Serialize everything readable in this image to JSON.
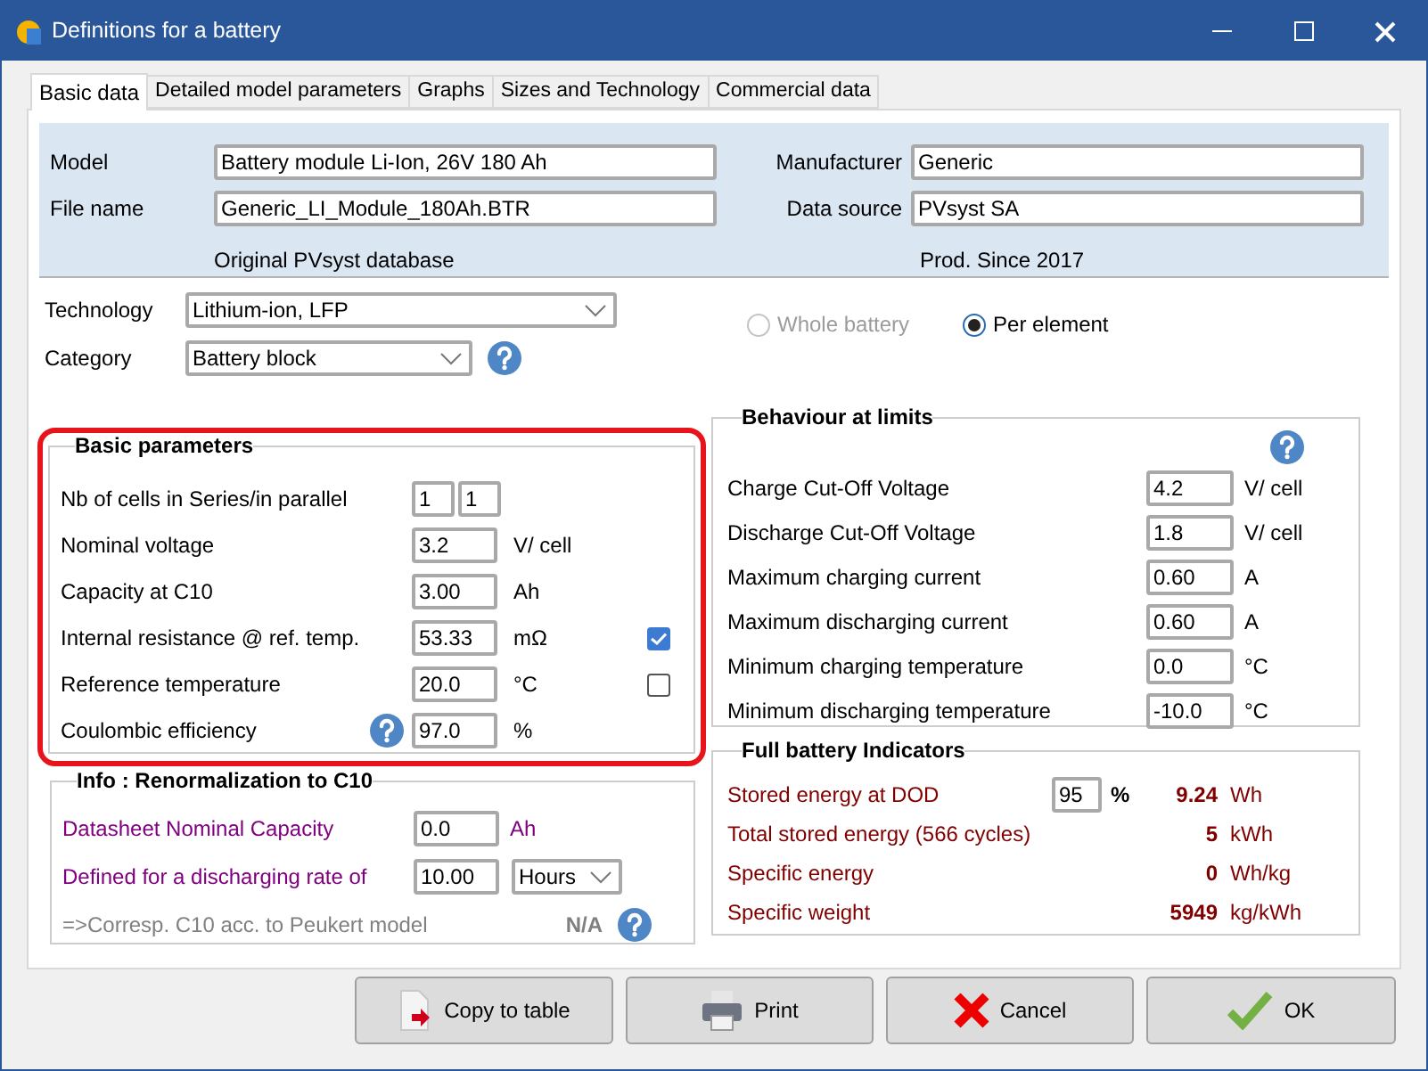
{
  "window": {
    "title": "Definitions for a battery"
  },
  "tabs": [
    {
      "label": "Basic data",
      "selected": true
    },
    {
      "label": "Detailed model parameters",
      "selected": false
    },
    {
      "label": "Graphs",
      "selected": false
    },
    {
      "label": "Sizes and Technology",
      "selected": false
    },
    {
      "label": "Commercial data",
      "selected": false
    }
  ],
  "identity": {
    "left": [
      {
        "label": "Model",
        "value": "Battery module Li-Ion, 26V 180 Ah"
      },
      {
        "label": "File name",
        "value": "Generic_LI_Module_180Ah.BTR"
      }
    ],
    "left_note": "Original PVsyst database",
    "right": [
      {
        "label": "Manufacturer",
        "value": "Generic"
      },
      {
        "label": "Data source",
        "value": "PVsyst SA"
      }
    ],
    "right_note": "Prod. Since 2017"
  },
  "technology": {
    "label": "Technology",
    "value": "Lithium-ion, LFP"
  },
  "category": {
    "label": "Category",
    "value": "Battery block"
  },
  "scope_options": [
    {
      "label": "Whole battery",
      "selected": false,
      "disabled": true
    },
    {
      "label": "Per element",
      "selected": true,
      "disabled": false
    }
  ],
  "basic_parameters": {
    "title": "Basic parameters",
    "highlighted": true,
    "rows": [
      {
        "kind": "pair",
        "label": "Nb of cells in Series/in parallel",
        "values": [
          "1",
          "1"
        ]
      },
      {
        "kind": "field",
        "label": "Nominal voltage",
        "value": "3.2",
        "unit": "V/ cell"
      },
      {
        "kind": "field",
        "label": "Capacity at C10",
        "value": "3.00",
        "unit": "Ah"
      },
      {
        "kind": "checkbox",
        "label": "Internal resistance @ ref. temp.",
        "value": "53.33",
        "unit": "mΩ",
        "checked": true
      },
      {
        "kind": "checkbox",
        "label": "Reference temperature",
        "value": "20.0",
        "unit": "°C",
        "checked": false
      },
      {
        "kind": "help",
        "label": "Coulombic efficiency",
        "value": "97.0",
        "unit": "%"
      }
    ]
  },
  "renormalization": {
    "title": "Info : Renormalization to C10",
    "rows": [
      {
        "kind": "field",
        "label": "Datasheet Nominal Capacity",
        "value": "0.0",
        "unit": "Ah"
      },
      {
        "kind": "select",
        "label": "Defined for a discharging rate of",
        "value": "10.00",
        "option": "Hours"
      },
      {
        "kind": "result",
        "label": "=>Corresp. C10 acc. to Peukert model",
        "result": "N/A"
      }
    ]
  },
  "behaviour": {
    "title": "Behaviour at limits",
    "rows": [
      {
        "label": "Charge Cut-Off Voltage",
        "value": "4.2",
        "unit": "V/ cell"
      },
      {
        "label": "Discharge Cut-Off Voltage",
        "value": "1.8",
        "unit": "V/ cell"
      },
      {
        "label": "Maximum charging current",
        "value": "0.60",
        "unit": "A"
      },
      {
        "label": "Maximum discharging current",
        "value": "0.60",
        "unit": "A"
      },
      {
        "label": "Minimum charging temperature",
        "value": "0.0",
        "unit": "°C"
      },
      {
        "label": "Minimum discharging temperature",
        "value": "-10.0",
        "unit": "°C"
      }
    ]
  },
  "indicators": {
    "title": "Full battery Indicators",
    "rows": [
      {
        "kind": "input",
        "label": "Stored energy at DOD",
        "value": "95",
        "unit": "%",
        "result": "9.24",
        "result_unit": "Wh"
      },
      {
        "kind": "result",
        "label": "Total stored energy (566 cycles)",
        "result": "5",
        "result_unit": "kWh"
      },
      {
        "kind": "result",
        "label": "Specific energy",
        "result": "0",
        "result_unit": "Wh/kg"
      },
      {
        "kind": "result",
        "label": "Specific weight",
        "result": "5949",
        "result_unit": "kg/kWh"
      }
    ]
  },
  "buttons": [
    {
      "kind": "copy",
      "label": "Copy to table"
    },
    {
      "kind": "print",
      "label": "Print"
    },
    {
      "kind": "cancel",
      "label": "Cancel"
    },
    {
      "kind": "ok",
      "label": "OK"
    }
  ]
}
